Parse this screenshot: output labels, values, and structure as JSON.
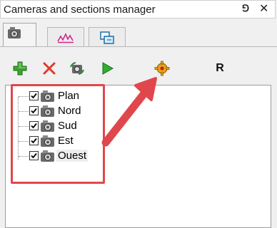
{
  "window": {
    "title": "Cameras and sections manager",
    "pin_glyph": "⅁",
    "close_glyph": "✕"
  },
  "tabs": [
    {
      "icon": "camera-icon",
      "active": true
    },
    {
      "icon": "chart-icon",
      "active": false
    },
    {
      "icon": "section-view-icon",
      "active": false
    }
  ],
  "toolbar": {
    "add_icon": "plus-icon",
    "delete_icon": "red-x-icon",
    "refresh_icon": "camera-refresh-icon",
    "play_icon": "play-icon",
    "settings_icon": "gear-icon",
    "r_label": "R"
  },
  "tree": {
    "items": [
      {
        "label": "Plan",
        "checked": true
      },
      {
        "label": "Nord",
        "checked": true
      },
      {
        "label": "Sud",
        "checked": true
      },
      {
        "label": "Est",
        "checked": true
      },
      {
        "label": "Ouest",
        "checked": true,
        "selected": true
      }
    ]
  },
  "annotation": {
    "highlight_color": "#e0474c"
  }
}
